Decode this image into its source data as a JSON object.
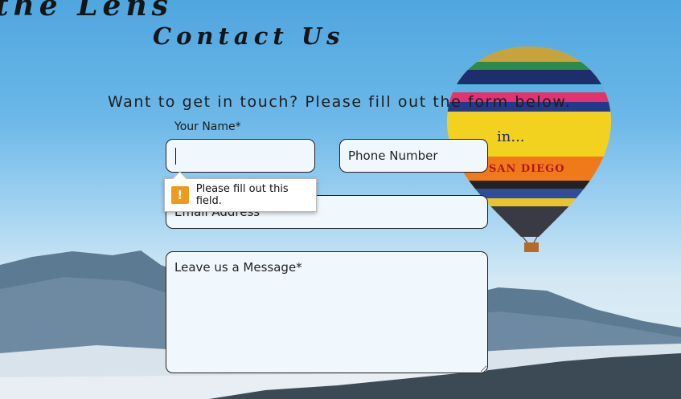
{
  "header": {
    "brand": "the Lens",
    "page_title": "Contact Us"
  },
  "form": {
    "intro": "Want to get in touch? Please fill out the form below.",
    "name_label": "Your Name*",
    "name_value": "",
    "phone_placeholder": "Phone Number",
    "email_placeholder": "Email Address",
    "message_placeholder": "Leave us a Message*"
  },
  "validation": {
    "message": "Please fill out this field.",
    "icon": "warning-icon"
  },
  "balloon": {
    "text_line1": "in...",
    "text_line2": "SAN DIEGO"
  },
  "colors": {
    "field_bg": "#f1f8fd",
    "warning": "#f09a1b"
  }
}
